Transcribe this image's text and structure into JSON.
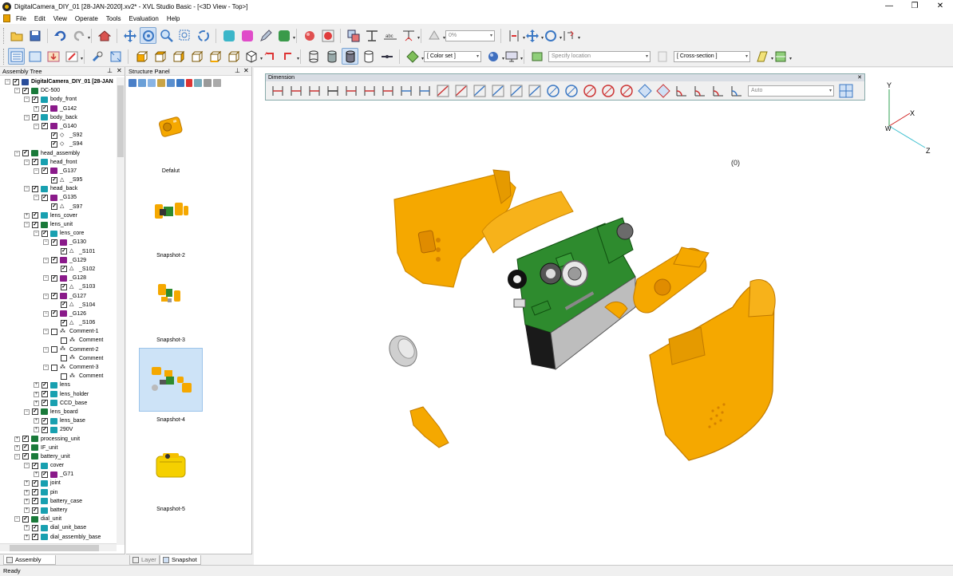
{
  "window": {
    "title": "DigitalCamera_DIY_01 [28-JAN-2020].xv2* - XVL Studio Basic - [<3D View - Top>]",
    "minimize": "—",
    "restore": "❐",
    "close": "✕"
  },
  "menu": [
    "File",
    "Edit",
    "View",
    "Operate",
    "Tools",
    "Evaluation",
    "Help"
  ],
  "toolbar": {
    "opacity_value": "0%",
    "color_set": "[ Color set ]",
    "specify_location": "Specify location",
    "cross_section": "[ Cross-section ]"
  },
  "assembly_tree": {
    "title": "Assembly Tree",
    "pin": "📌",
    "close": "✕",
    "rows": [
      {
        "label": "DigitalCamera_DIY_01 [28-JAN",
        "lvl": 0,
        "exp": "-",
        "checked": true,
        "icon": "root",
        "bold": true
      },
      {
        "label": "DC-500",
        "lvl": 1,
        "exp": "-",
        "checked": true,
        "icon": "asm"
      },
      {
        "label": "body_front",
        "lvl": 2,
        "exp": "-",
        "checked": true,
        "icon": "part"
      },
      {
        "label": "_G142",
        "lvl": 3,
        "exp": "+",
        "checked": true,
        "icon": "group"
      },
      {
        "label": "body_back",
        "lvl": 2,
        "exp": "-",
        "checked": true,
        "icon": "part"
      },
      {
        "label": "_G140",
        "lvl": 3,
        "exp": "-",
        "checked": true,
        "icon": "group"
      },
      {
        "label": "_S92",
        "lvl": 4,
        "exp": "",
        "checked": true,
        "icon": "shape"
      },
      {
        "label": "_S94",
        "lvl": 4,
        "exp": "",
        "checked": true,
        "icon": "shape"
      },
      {
        "label": "head_assembly",
        "lvl": 1,
        "exp": "-",
        "checked": true,
        "icon": "asm"
      },
      {
        "label": "head_front",
        "lvl": 2,
        "exp": "-",
        "checked": true,
        "icon": "part"
      },
      {
        "label": "_G137",
        "lvl": 3,
        "exp": "-",
        "checked": true,
        "icon": "group"
      },
      {
        "label": "_S95",
        "lvl": 4,
        "exp": "",
        "checked": true,
        "icon": "tri"
      },
      {
        "label": "head_back",
        "lvl": 2,
        "exp": "-",
        "checked": true,
        "icon": "part"
      },
      {
        "label": "_G135",
        "lvl": 3,
        "exp": "-",
        "checked": true,
        "icon": "group"
      },
      {
        "label": "_S97",
        "lvl": 4,
        "exp": "",
        "checked": true,
        "icon": "tri"
      },
      {
        "label": "lens_cover",
        "lvl": 2,
        "exp": "+",
        "checked": true,
        "icon": "part"
      },
      {
        "label": "lens_unit",
        "lvl": 2,
        "exp": "-",
        "checked": true,
        "icon": "asm"
      },
      {
        "label": "lens_core",
        "lvl": 3,
        "exp": "-",
        "checked": true,
        "icon": "part"
      },
      {
        "label": "_G130",
        "lvl": 4,
        "exp": "-",
        "checked": true,
        "icon": "group"
      },
      {
        "label": "_S101",
        "lvl": 5,
        "exp": "",
        "checked": true,
        "icon": "tri"
      },
      {
        "label": "_G129",
        "lvl": 4,
        "exp": "-",
        "checked": true,
        "icon": "group"
      },
      {
        "label": "_S102",
        "lvl": 5,
        "exp": "",
        "checked": true,
        "icon": "tri"
      },
      {
        "label": "_G128",
        "lvl": 4,
        "exp": "-",
        "checked": true,
        "icon": "group"
      },
      {
        "label": "_S103",
        "lvl": 5,
        "exp": "",
        "checked": true,
        "icon": "tri"
      },
      {
        "label": "_G127",
        "lvl": 4,
        "exp": "-",
        "checked": true,
        "icon": "group"
      },
      {
        "label": "_S104",
        "lvl": 5,
        "exp": "",
        "checked": true,
        "icon": "tri"
      },
      {
        "label": "_G126",
        "lvl": 4,
        "exp": "-",
        "checked": true,
        "icon": "group"
      },
      {
        "label": "_S106",
        "lvl": 5,
        "exp": "",
        "checked": true,
        "icon": "tri"
      },
      {
        "label": "Comment-1",
        "lvl": 4,
        "exp": "-",
        "checked": false,
        "icon": "comment"
      },
      {
        "label": "Comment",
        "lvl": 5,
        "exp": "",
        "checked": false,
        "icon": "comment"
      },
      {
        "label": "Comment-2",
        "lvl": 4,
        "exp": "-",
        "checked": false,
        "icon": "comment"
      },
      {
        "label": "Comment",
        "lvl": 5,
        "exp": "",
        "checked": false,
        "icon": "comment"
      },
      {
        "label": "Comment-3",
        "lvl": 4,
        "exp": "-",
        "checked": false,
        "icon": "comment"
      },
      {
        "label": "Comment",
        "lvl": 5,
        "exp": "",
        "checked": false,
        "icon": "comment"
      },
      {
        "label": "lens",
        "lvl": 3,
        "exp": "+",
        "checked": true,
        "icon": "part"
      },
      {
        "label": "lens_holder",
        "lvl": 3,
        "exp": "+",
        "checked": true,
        "icon": "part"
      },
      {
        "label": "CCD_base",
        "lvl": 3,
        "exp": "+",
        "checked": true,
        "icon": "part"
      },
      {
        "label": "lens_board",
        "lvl": 2,
        "exp": "-",
        "checked": true,
        "icon": "asm"
      },
      {
        "label": "lens_base",
        "lvl": 3,
        "exp": "+",
        "checked": true,
        "icon": "part"
      },
      {
        "label": "290V",
        "lvl": 3,
        "exp": "+",
        "checked": true,
        "icon": "part"
      },
      {
        "label": "processing_unit",
        "lvl": 1,
        "exp": "+",
        "checked": true,
        "icon": "asm"
      },
      {
        "label": "IF_unit",
        "lvl": 1,
        "exp": "+",
        "checked": true,
        "icon": "asm"
      },
      {
        "label": "battery_unit",
        "lvl": 1,
        "exp": "-",
        "checked": true,
        "icon": "asm"
      },
      {
        "label": "cover",
        "lvl": 2,
        "exp": "-",
        "checked": true,
        "icon": "part"
      },
      {
        "label": "_G71",
        "lvl": 3,
        "exp": "+",
        "checked": true,
        "icon": "group"
      },
      {
        "label": "joint",
        "lvl": 2,
        "exp": "+",
        "checked": true,
        "icon": "part"
      },
      {
        "label": "pin",
        "lvl": 2,
        "exp": "+",
        "checked": true,
        "icon": "part"
      },
      {
        "label": "battery_case",
        "lvl": 2,
        "exp": "+",
        "checked": true,
        "icon": "part"
      },
      {
        "label": "battery",
        "lvl": 2,
        "exp": "+",
        "checked": true,
        "icon": "part"
      },
      {
        "label": "dial_unit",
        "lvl": 1,
        "exp": "-",
        "checked": true,
        "icon": "asm"
      },
      {
        "label": "dial_unit_base",
        "lvl": 2,
        "exp": "+",
        "checked": true,
        "icon": "part"
      },
      {
        "label": "dial_assembly_base",
        "lvl": 2,
        "exp": "+",
        "checked": true,
        "icon": "part"
      }
    ],
    "tab_label": "Assembly Tree"
  },
  "structure_panel": {
    "title": "Structure Panel",
    "pin": "📌",
    "close": "✕",
    "snapshots": [
      {
        "label": "Defalut"
      },
      {
        "label": "Snapshot-2"
      },
      {
        "label": "Snapshot-3"
      },
      {
        "label": "Snapshot-4",
        "selected": true
      },
      {
        "label": "Snapshot-5"
      }
    ],
    "tabs": [
      "Layer",
      "Snapshot"
    ]
  },
  "dimension_bar": {
    "title": "Dimension",
    "mode": "Auto",
    "close": "✕"
  },
  "viewport": {
    "note_marker": "(0)",
    "axes": {
      "y": "Y",
      "x": "X",
      "z": "Z",
      "w": "W"
    }
  },
  "status": {
    "text": "Ready"
  },
  "colors": {
    "accent_yellow": "#f5a800",
    "board_green": "#2e8b2e",
    "selected_bg": "#cde3f7"
  }
}
